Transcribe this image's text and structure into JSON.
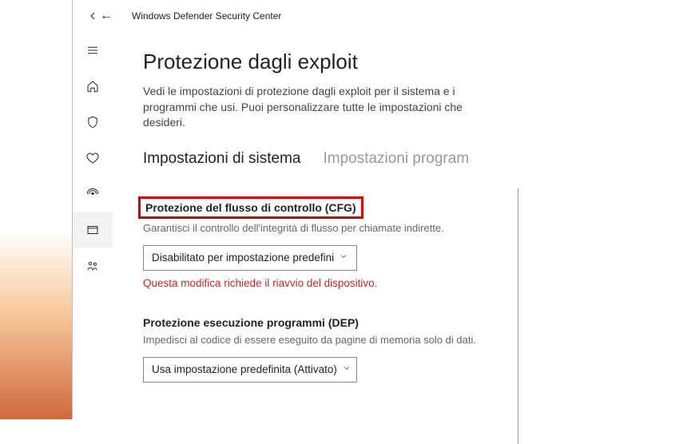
{
  "window": {
    "title": "Windows Defender Security Center"
  },
  "page": {
    "title": "Protezione dagli exploit",
    "description": "Vedi le impostazioni di protezione dagli exploit per il sistema e i programmi che usi. Puoi personalizzare tutte le impostazioni che desideri."
  },
  "tabs": {
    "system": "Impostazioni di sistema",
    "program": "Impostazioni program"
  },
  "settings": {
    "cfg": {
      "title": "Protezione del flusso di controllo (CFG)",
      "desc": "Garantisci il controllo dell'integrità di flusso per chiamate indirette.",
      "value": "Disabilitato per impostazione predefini",
      "warning": "Questa modifica richiede il riavvio del dispositivo."
    },
    "dep": {
      "title": "Protezione esecuzione programmi (DEP)",
      "desc": "Impedisci al codice di essere eseguito da pagine di memoria solo di dati.",
      "value": "Usa impostazione predefinita (Attivato)"
    }
  }
}
